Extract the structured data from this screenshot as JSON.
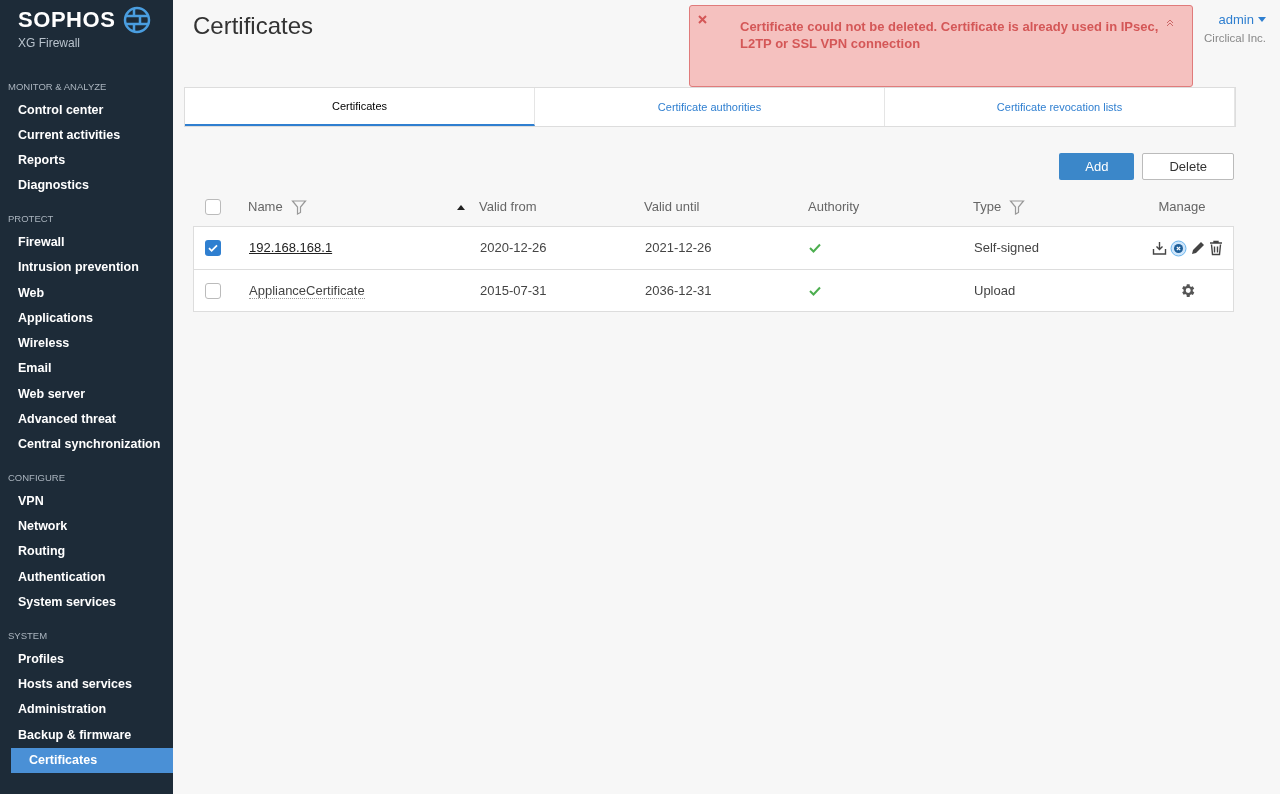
{
  "brand": {
    "name": "SOPHOS",
    "product": "XG Firewall"
  },
  "sidebar": {
    "sections": [
      {
        "title": "MONITOR & ANALYZE",
        "items": [
          {
            "label": "Control center",
            "selected": false
          },
          {
            "label": "Current activities",
            "selected": false
          },
          {
            "label": "Reports",
            "selected": false
          },
          {
            "label": "Diagnostics",
            "selected": false
          }
        ]
      },
      {
        "title": "PROTECT",
        "items": [
          {
            "label": "Firewall",
            "selected": false
          },
          {
            "label": "Intrusion prevention",
            "selected": false
          },
          {
            "label": "Web",
            "selected": false
          },
          {
            "label": "Applications",
            "selected": false
          },
          {
            "label": "Wireless",
            "selected": false
          },
          {
            "label": "Email",
            "selected": false
          },
          {
            "label": "Web server",
            "selected": false
          },
          {
            "label": "Advanced threat",
            "selected": false
          },
          {
            "label": "Central synchronization",
            "selected": false
          }
        ]
      },
      {
        "title": "CONFIGURE",
        "items": [
          {
            "label": "VPN",
            "selected": false
          },
          {
            "label": "Network",
            "selected": false
          },
          {
            "label": "Routing",
            "selected": false
          },
          {
            "label": "Authentication",
            "selected": false
          },
          {
            "label": "System services",
            "selected": false
          }
        ]
      },
      {
        "title": "SYSTEM",
        "items": [
          {
            "label": "Profiles",
            "selected": false
          },
          {
            "label": "Hosts and services",
            "selected": false
          },
          {
            "label": "Administration",
            "selected": false
          },
          {
            "label": "Backup & firmware",
            "selected": false
          },
          {
            "label": "Certificates",
            "selected": true
          }
        ]
      }
    ]
  },
  "page_title": "Certificates",
  "user": {
    "name": "admin",
    "company": "Circlical Inc."
  },
  "error": {
    "message": "Certificate could not be deleted. Certificate is already used in IPsec, L2TP or SSL VPN connection"
  },
  "tabs": [
    {
      "label": "Certificates",
      "selected": true
    },
    {
      "label": "Certificate authorities",
      "selected": false
    },
    {
      "label": "Certificate revocation lists",
      "selected": false
    }
  ],
  "buttons": [
    "Add",
    "Delete"
  ],
  "table": {
    "select_all": {
      "checked": false
    },
    "columns": [
      "Name",
      "Valid from",
      "Valid until",
      "Authority",
      "Type",
      "Manage"
    ],
    "rows": [
      {
        "selected": true,
        "name": "192.168.168.1",
        "valid_from": "2020-12-26",
        "valid_until": "2021-12-26",
        "authority": true,
        "type": "Self-signed",
        "kind": "custom"
      },
      {
        "selected": false,
        "name": "ApplianceCertificate",
        "valid_from": "2015-07-31",
        "valid_until": "2036-12-31",
        "authority": true,
        "type": "Upload",
        "kind": "builtin"
      }
    ]
  }
}
